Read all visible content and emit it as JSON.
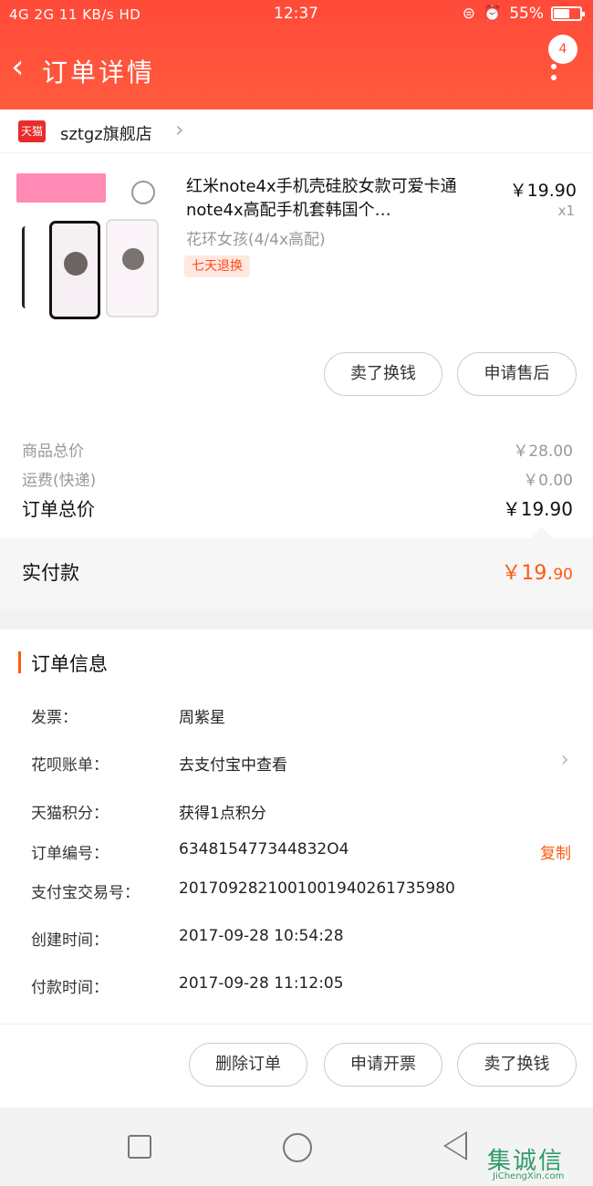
{
  "status_bar": {
    "network": "4G 2G 11 KB/s HD",
    "time": "12:37",
    "battery": "55%"
  },
  "header": {
    "title": "订单详情",
    "badge_count": "4"
  },
  "shop": {
    "platform_badge": "天猫",
    "name": "sztgz旗舰店"
  },
  "product": {
    "title": "红米note4x手机壳硅胶女款可爱卡通note4x高配手机套韩国个…",
    "price": "￥19.90",
    "quantity": "x1",
    "sku": "花环女孩(4/4x高配)",
    "tag": "七天退换",
    "buttons": [
      "卖了换钱",
      "申请售后"
    ]
  },
  "prices": {
    "goods_total_label": "商品总价",
    "goods_total_value": "￥28.00",
    "shipping_label": "运费(快递)",
    "shipping_value": "￥0.00",
    "order_total_label": "订单总价",
    "order_total_value": "￥19.90"
  },
  "paid": {
    "label": "实付款",
    "value_main": "￥19.",
    "value_cents": "90"
  },
  "order_info": {
    "title": "订单信息",
    "rows": [
      {
        "key": "发票：",
        "value": "周紫星"
      },
      {
        "key": "花呗账单：",
        "value": "去支付宝中查看"
      },
      {
        "key": "天猫积分：",
        "value": "获得1点积分"
      },
      {
        "key": "订单编号：",
        "value": "634815477344832O4"
      },
      {
        "key": "支付宝交易号：",
        "value": "2017092821001001940261735980"
      },
      {
        "key": "创建时间：",
        "value": "2017-09-28 10:54:28"
      },
      {
        "key": "付款时间：",
        "value": "2017-09-28 11:12:05"
      }
    ],
    "copy_label": "复制"
  },
  "actions": {
    "buttons": [
      "删除订单",
      "申请开票",
      "卖了换钱"
    ]
  },
  "watermark": {
    "logo": "集诚信",
    "url": "JiChengXin.com"
  },
  "colors": {
    "brand_red": "#ff4a3a",
    "accent_orange": "#ff5a10"
  }
}
